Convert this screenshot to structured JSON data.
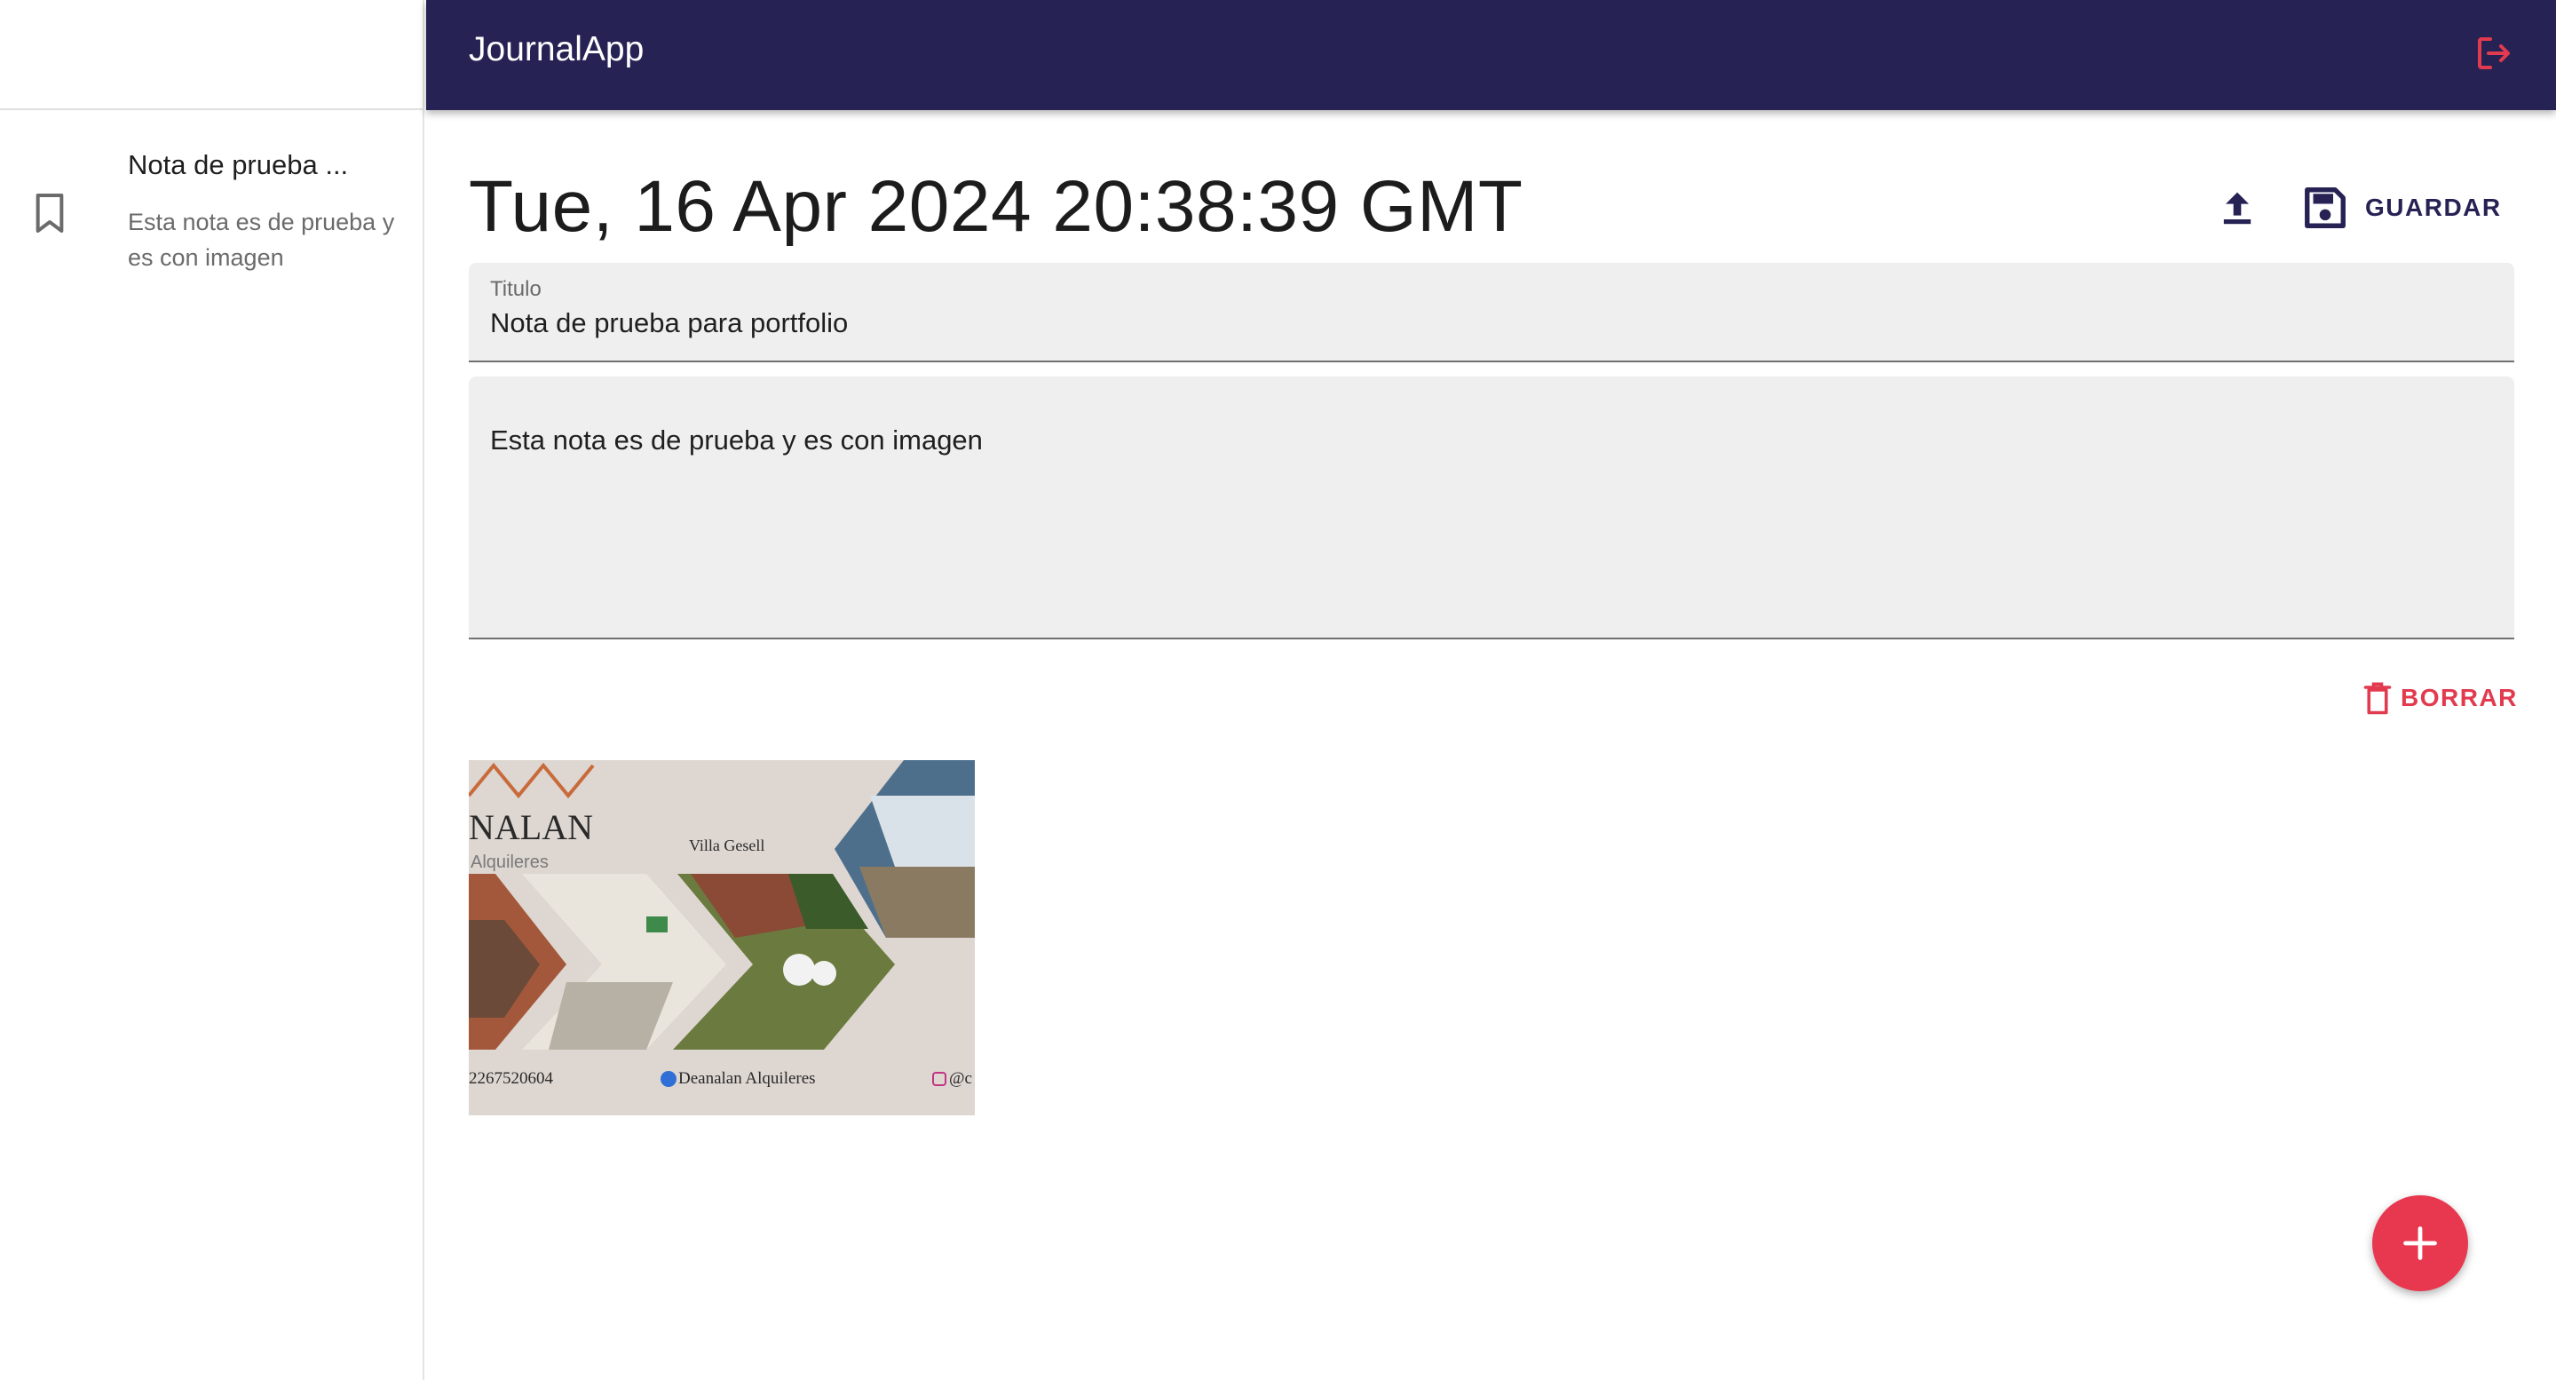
{
  "app": {
    "title": "JournalApp",
    "accent_color": "#262254",
    "danger_color": "#e23a4f"
  },
  "sidebar": {
    "notes": [
      {
        "icon": "bookmark-icon",
        "title": "Nota de prueba ...",
        "body": "Esta nota es de prueba y es con imagen"
      }
    ]
  },
  "note": {
    "date": "Tue, 16 Apr 2024 20:38:39 GMT",
    "title_label": "Titulo",
    "title_value": "Nota de prueba para portfolio",
    "body_value": "Esta nota es de prueba y es con imagen",
    "save_label": "GUARDAR",
    "delete_label": "BORRAR"
  },
  "image": {
    "brand": "NALAN",
    "brand_sub": "Alquileres",
    "location": "Villa Gesell",
    "phone": "2267520604",
    "facebook": "Deanalan Alquileres",
    "instagram": "@c"
  },
  "fab": {
    "icon": "plus-icon"
  }
}
